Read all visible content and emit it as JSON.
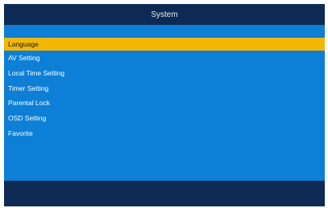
{
  "window": {
    "title": "System"
  },
  "menu": {
    "items": [
      {
        "label": "Language",
        "selected": true
      },
      {
        "label": "AV Setting",
        "selected": false
      },
      {
        "label": "Local Time Setting",
        "selected": false
      },
      {
        "label": "Timer Setting",
        "selected": false
      },
      {
        "label": "Parental Lock",
        "selected": false
      },
      {
        "label": "OSD Setting",
        "selected": false
      },
      {
        "label": "Favorite",
        "selected": false
      }
    ]
  },
  "colors": {
    "background": "#0d7fd6",
    "header_footer": "#0d2a55",
    "highlight": "#f2b705",
    "text": "#ffffff"
  }
}
